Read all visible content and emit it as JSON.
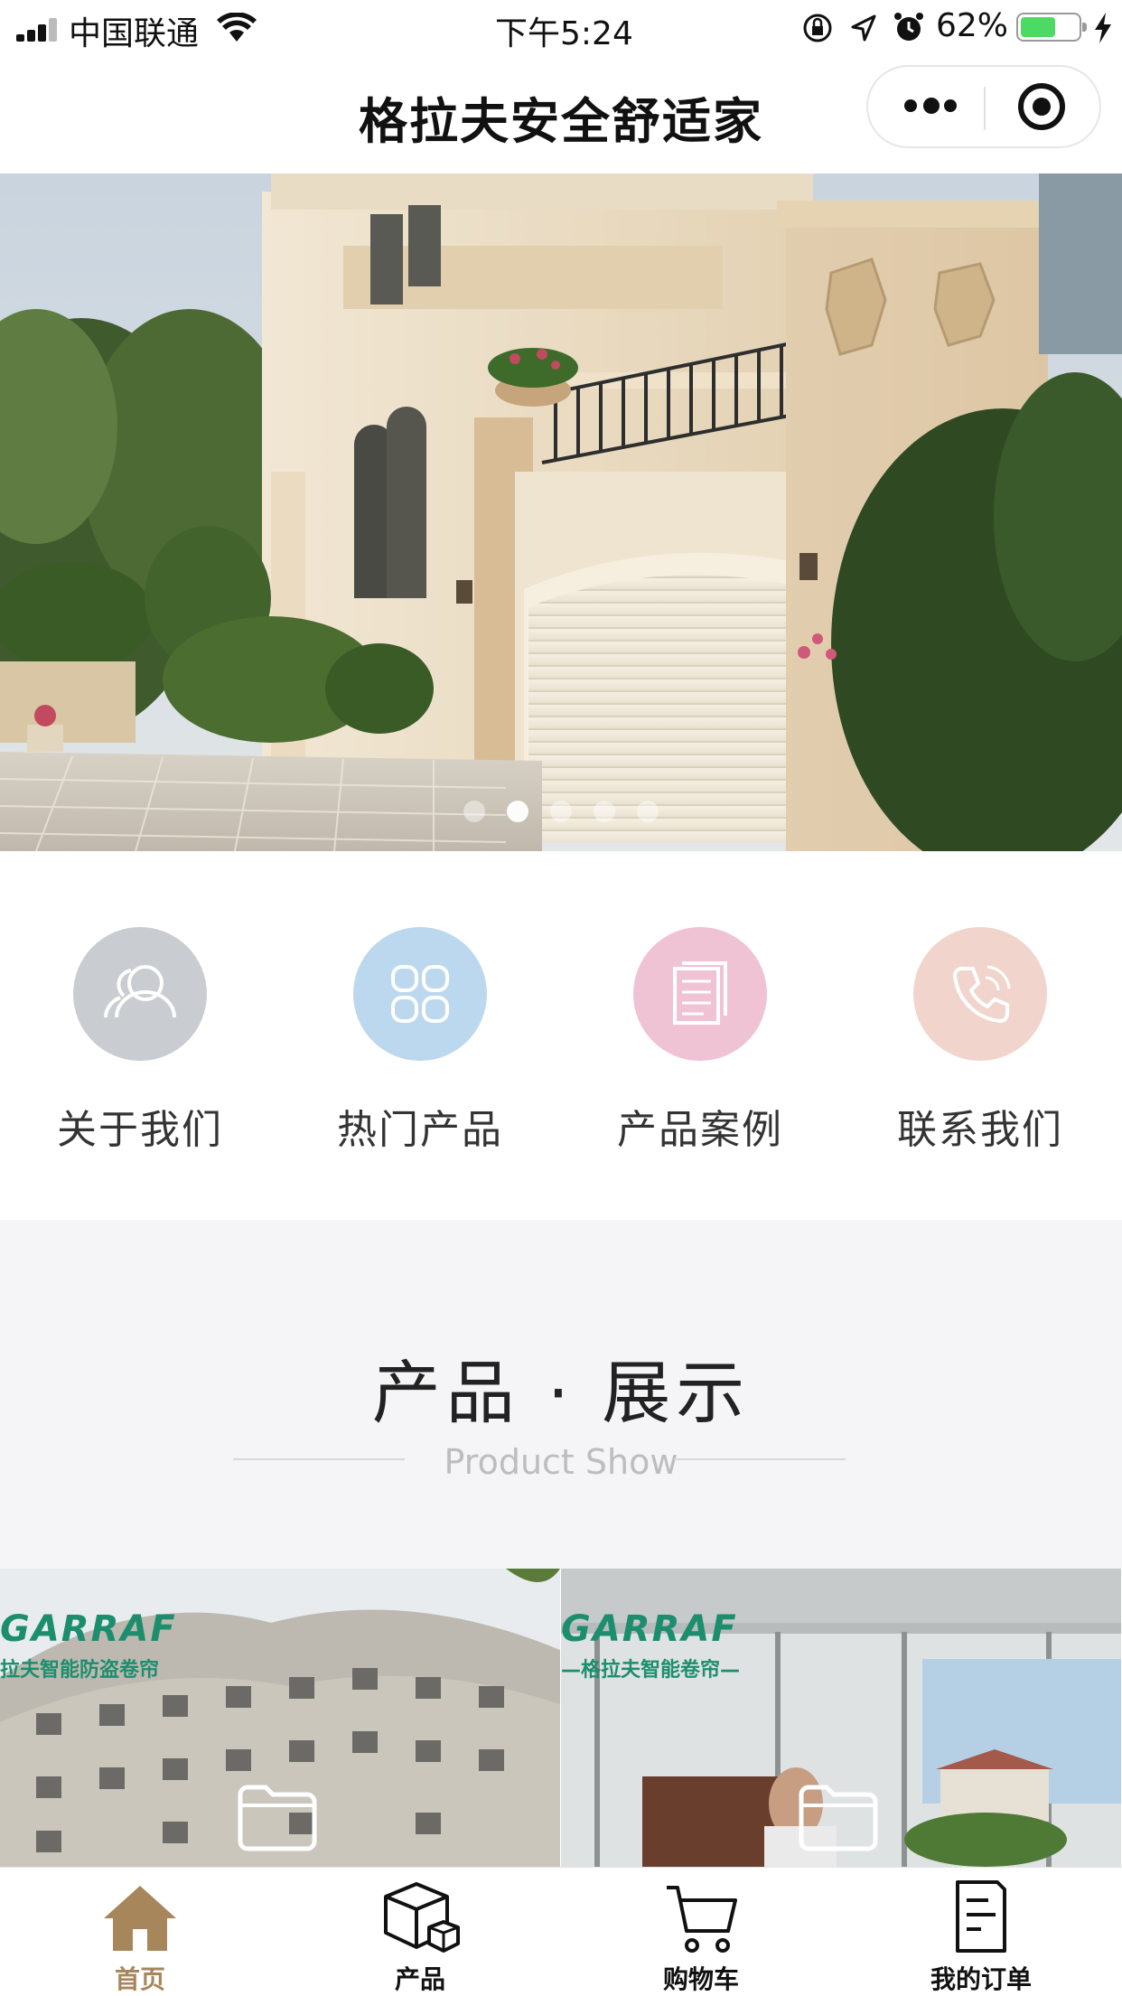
{
  "status_bar": {
    "carrier": "中国联通",
    "time": "下午5:24",
    "battery_percent": "62%",
    "battery_level": 0.62
  },
  "nav": {
    "title": "格拉夫安全舒适家"
  },
  "banner": {
    "slide_count": 5,
    "active_index": 1
  },
  "quick_menu": {
    "items": [
      {
        "label": "关于我们",
        "icon": "users-icon",
        "color": "#c9ccd1"
      },
      {
        "label": "热门产品",
        "icon": "grid-icon",
        "color": "#bcd8ee"
      },
      {
        "label": "产品案例",
        "icon": "document-icon",
        "color": "#efc3d4"
      },
      {
        "label": "联系我们",
        "icon": "phone-icon",
        "color": "#f1d5cc"
      }
    ]
  },
  "product_show": {
    "title": "产品 · 展示",
    "subtitle": "Product Show"
  },
  "products": [
    {
      "brand": "GARRAF",
      "brand_sub": "拉夫智能防盗卷帘",
      "icon": "folder-icon"
    },
    {
      "brand": "GARRAF",
      "brand_sub": "—格拉夫智能卷帘—",
      "icon": "folder-icon"
    }
  ],
  "tab_bar": {
    "active": 0,
    "accent_color": "#a8865b",
    "tabs": [
      {
        "label": "首页",
        "icon": "home-icon"
      },
      {
        "label": "产品",
        "icon": "box-icon"
      },
      {
        "label": "购物车",
        "icon": "cart-icon"
      },
      {
        "label": "我的订单",
        "icon": "order-icon"
      }
    ]
  }
}
